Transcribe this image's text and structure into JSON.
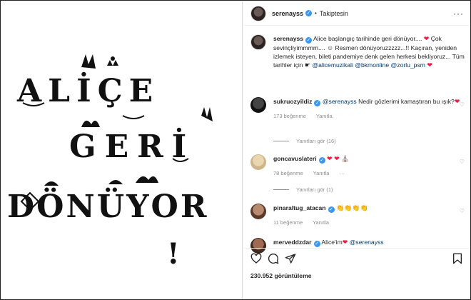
{
  "artwork": {
    "line1": "ALİÇE",
    "line2": "GERİ",
    "line3": "DÖNÜYOR",
    "line4": "!"
  },
  "header": {
    "username": "serenayss",
    "verified_mark": "✓",
    "separator": "•",
    "follow_status": "Takiptesin",
    "more_label": "···"
  },
  "caption": {
    "username": "serenayss",
    "text_1": " Alice başlangıç tarihinde geri dönüyor.... ",
    "heart_1": "❤",
    "text_2": " Çok sevinçliyimmmm.... ",
    "emoji_smile": "☺",
    "text_3": " Resmen dönüyoruzzzzz...!! Kaçıran, yeniden izlemek isteyen, bileti pandemiye denk gelen herkesi bekliyoruz... Tüm tarihler için ",
    "emoji_point": "☛",
    "mention_1": "@alicemuzikali",
    "mention_2": "@bkmonline",
    "mention_3": "@zorlu_psm",
    "heart_2": "❤"
  },
  "comments": [
    {
      "username": "sukruozyildiz",
      "verified": true,
      "mention": "@serenayss",
      "text": " Nedir gözlerimi kamaştıran bu ışık?",
      "emoji": "❤",
      "likes": "173 beğenme",
      "reply": "Yanıtla",
      "replies": "Yanıtları gör (16)"
    },
    {
      "username": "goncavuslateri",
      "verified": true,
      "mention": "",
      "text": " ",
      "emoji": "❤ ❤ ⛪",
      "likes": "78 beğenme",
      "reply": "Yanıtla",
      "more": "···",
      "replies": "Yanıtları gör (1)"
    },
    {
      "username": "pinaraltug_atacan",
      "verified": true,
      "mention": "",
      "text": " ",
      "emoji": "👏👏👏👏",
      "likes": "11 beğenme",
      "reply": "Yanıtla",
      "replies": ""
    },
    {
      "username": "merveddzdar",
      "verified": true,
      "mention": "@serenayss",
      "text": " Alice'im",
      "emoji": "❤",
      "likes": "",
      "reply": "",
      "replies": ""
    }
  ],
  "footer": {
    "views": "230.952 görüntüleme"
  },
  "colors": {
    "verified": "#3897f0",
    "heart": "#ed1c43",
    "link": "#00376b",
    "muted": "#8e8e8e"
  }
}
